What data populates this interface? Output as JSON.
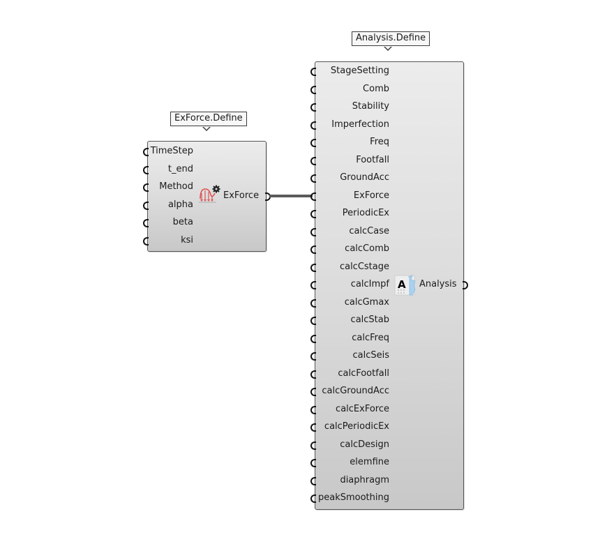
{
  "components": {
    "exforce": {
      "tooltip": "ExForce.Define",
      "name": "ExForce",
      "icon": "exforce-load-gear-icon",
      "inputs": [
        "TimeStep",
        "t_end",
        "Method",
        "alpha",
        "beta",
        "ksi"
      ],
      "outputs": [
        "ExForce"
      ]
    },
    "analysis": {
      "tooltip": "Analysis.Define",
      "name": "Analysis",
      "icon": "analysis-document-icon",
      "inputs": [
        "StageSetting",
        "Comb",
        "Stability",
        "Imperfection",
        "Freq",
        "Footfall",
        "GroundAcc",
        "ExForce",
        "PeriodicEx",
        "calcCase",
        "calcComb",
        "calcCstage",
        "calcImpf",
        "calcGmax",
        "calcStab",
        "calcFreq",
        "calcSeis",
        "calcFootfall",
        "calcGroundAcc",
        "calcExForce",
        "calcPeriodicEx",
        "calcDesign",
        "elemfine",
        "diaphragm",
        "peakSmoothing"
      ],
      "outputs": [
        "Analysis"
      ]
    }
  },
  "wires": [
    {
      "from": "exforce.output",
      "to": "analysis.input.ExForce",
      "color": "#5a5a5a"
    }
  ]
}
